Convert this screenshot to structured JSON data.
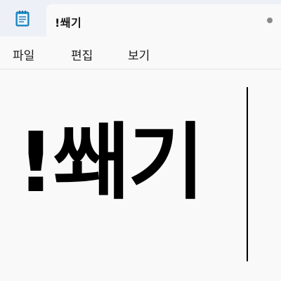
{
  "window": {
    "app_icon": "notepad-icon",
    "tab_title": "!쐐기",
    "unsaved_indicator": "unsaved-dot-icon"
  },
  "menubar": {
    "file_label": "파일",
    "edit_label": "편집",
    "view_label": "보기"
  },
  "editor": {
    "content": "!쐐기"
  },
  "colors": {
    "tabbar_background": "#eef0f7",
    "editor_background": "#f9f9f9",
    "icon_accent": "#1e8fd6",
    "text": "#000000"
  }
}
